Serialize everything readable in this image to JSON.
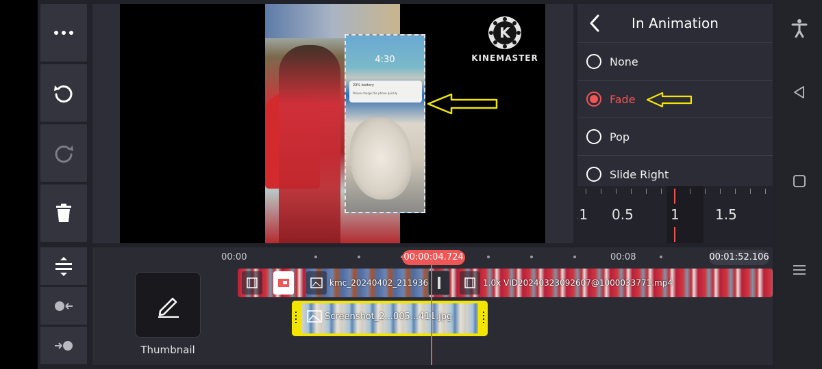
{
  "app": {
    "watermark": "KINEMASTER",
    "watermark_logo_letter": "K"
  },
  "toolbar": {
    "more_icon": "more-horizontal-icon",
    "undo_icon": "undo-icon",
    "redo_icon": "redo-icon",
    "delete_icon": "trash-icon"
  },
  "preview": {
    "overlay_clock": "4:30",
    "overlay_notif_title": "20% battery",
    "overlay_notif_body": "Please charge the phone quickly"
  },
  "animation_panel": {
    "title": "In Animation",
    "options": [
      {
        "label": "None",
        "selected": false
      },
      {
        "label": "Fade",
        "selected": true
      },
      {
        "label": "Pop",
        "selected": false
      },
      {
        "label": "Slide Right",
        "selected": false
      }
    ],
    "duration_ruler": {
      "labels": [
        ".1",
        "0.5",
        "1",
        "1.5"
      ],
      "selected": "1"
    }
  },
  "timeline": {
    "ticks": [
      "00:00",
      "00:08"
    ],
    "current_time": "00:00:04.724",
    "total_time": "00:01:52.106",
    "thumbnail_label": "Thumbnail",
    "main_clip_1_label": "kmc_20240402_211936@",
    "main_clip_2_label": "1.0x VID20240323092607@1000033771.mp4",
    "overlay_clip_label": "Screenshot_2...005...411.jpg"
  },
  "colors": {
    "accent": "#f05656",
    "overlay_selection": "#f2e600",
    "panel_bg": "#2c2c36",
    "app_bg": "#22222b"
  }
}
